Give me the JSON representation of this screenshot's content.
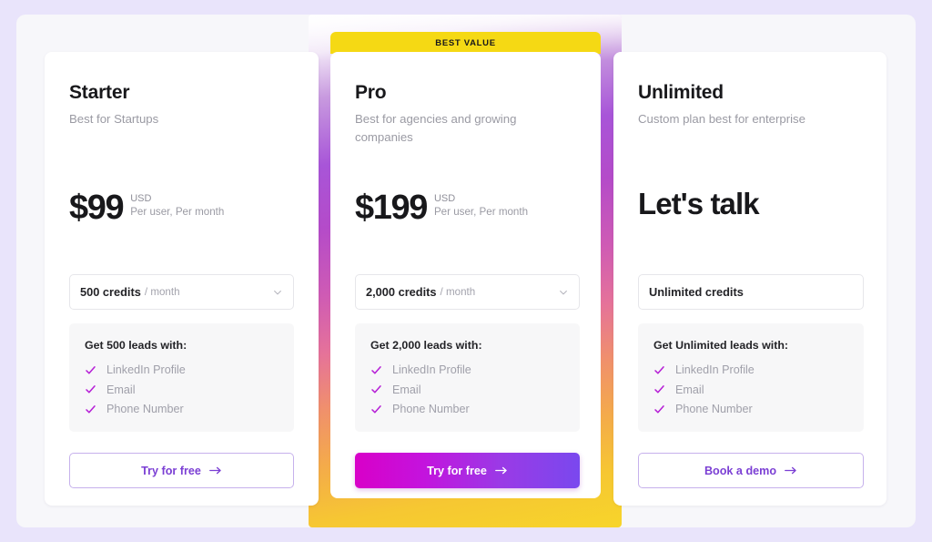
{
  "theme": {
    "page_background": "#e9e4fb",
    "panel_background": "#f7f7fa",
    "badge_background": "#f5d914",
    "accent_purple": "#7b3fd4",
    "check_color": "#b620d6",
    "cta_gradient_from": "#d800c8",
    "cta_gradient_to": "#7a48ee"
  },
  "featured_badge": {
    "label": "BEST VALUE"
  },
  "plans": [
    {
      "id": "starter",
      "name": "Starter",
      "tagline": "Best for Startups",
      "price_amount": "$99",
      "price_currency": "USD",
      "price_period": "Per user, Per month",
      "credits_amount": "500 credits",
      "credits_period": "/ month",
      "has_chevron": true,
      "chevron_icon": "chevron-down-icon",
      "features_title": "Get 500 leads with:",
      "features": [
        "LinkedIn Profile",
        "Email",
        "Phone Number"
      ],
      "cta_label": "Try for free",
      "cta_icon": "arrow-right-icon",
      "cta_style": "outline"
    },
    {
      "id": "pro",
      "name": "Pro",
      "tagline": "Best for agencies and growing companies",
      "price_amount": "$199",
      "price_currency": "USD",
      "price_period": "Per user, Per month",
      "credits_amount": "2,000 credits",
      "credits_period": "/ month",
      "has_chevron": true,
      "chevron_icon": "chevron-down-icon",
      "features_title": "Get 2,000 leads with:",
      "features": [
        "LinkedIn Profile",
        "Email",
        "Phone Number"
      ],
      "cta_label": "Try for free",
      "cta_icon": "arrow-right-icon",
      "cta_style": "gradient"
    },
    {
      "id": "unlimited",
      "name": "Unlimited",
      "tagline": "Custom plan best for enterprise",
      "price_text": "Let's talk",
      "credits_amount": "Unlimited credits",
      "credits_period": "",
      "has_chevron": false,
      "features_title": "Get Unlimited leads with:",
      "features": [
        "LinkedIn Profile",
        "Email",
        "Phone Number"
      ],
      "cta_label": "Book a demo",
      "cta_icon": "arrow-right-icon",
      "cta_style": "outline"
    }
  ]
}
